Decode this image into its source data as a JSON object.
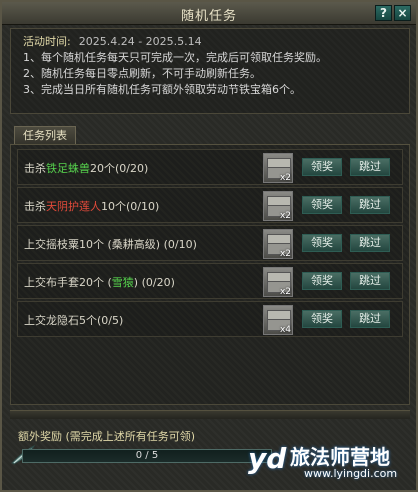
{
  "window": {
    "title": "随机任务",
    "help_label": "?",
    "close_label": "×"
  },
  "info": {
    "time_label": "活动时间:",
    "time_value": "2025.4.24 - 2025.5.14",
    "lines": [
      "1、每个随机任务每天只可完成一次，完成后可领取任务奖励。",
      "2、随机任务每日零点刷新，不可手动刷新任务。",
      "3、完成当日所有随机任务可额外领取劳动节铁宝箱6个。"
    ]
  },
  "tab": {
    "label": "任务列表"
  },
  "tasks": [
    {
      "prefix": "击杀",
      "highlight": "铁足蛛兽",
      "suffix": "20个(0/20)",
      "reward_count": "x2",
      "claim_label": "领奖",
      "skip_label": "跳过"
    },
    {
      "prefix": "击杀",
      "highlight": "天阴护莲人",
      "suffix": "10个(0/10)",
      "reward_count": "x2",
      "claim_label": "领奖",
      "skip_label": "跳过"
    },
    {
      "prefix": "上交摇枝粟10个 (桑耕高级) (0/10)",
      "highlight": "",
      "suffix": "",
      "reward_count": "x2",
      "claim_label": "领奖",
      "skip_label": "跳过"
    },
    {
      "prefix": "上交布手套20个 (",
      "highlight": "雪猿",
      "suffix": ") (0/20)",
      "reward_count": "x2",
      "claim_label": "领奖",
      "skip_label": "跳过"
    },
    {
      "prefix": "上交龙隐石5个(0/5)",
      "highlight": "",
      "suffix": "",
      "reward_count": "x4",
      "claim_label": "领奖",
      "skip_label": "跳过"
    }
  ],
  "bonus": {
    "title": "额外奖励 (需完成上述所有任务可领)",
    "progress_text": "0 / 5",
    "progress_fraction": 0
  },
  "watermark": {
    "logo": "yd",
    "brand": "旅法师营地",
    "url": "www.lyingdi.com"
  },
  "colors": {
    "highlight_green": "#56d24d",
    "highlight_red": "#e24a3a",
    "button_teal": "#2c6b63"
  }
}
